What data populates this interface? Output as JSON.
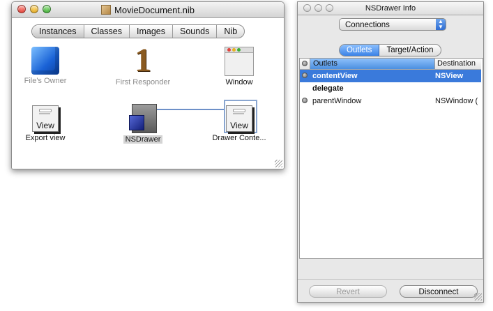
{
  "doc_window": {
    "title": "MovieDocument.nib",
    "tabs": [
      "Instances",
      "Classes",
      "Images",
      "Sounds",
      "Nib"
    ],
    "selected_tab": "Instances",
    "objects": [
      {
        "label": "File's Owner",
        "icon": "cube-icon",
        "dim": true
      },
      {
        "label": "First Responder",
        "icon": "first-responder-icon",
        "dim": true
      },
      {
        "label": "Window",
        "icon": "window-icon"
      },
      {
        "label": "Export view",
        "icon": "view-icon",
        "view_text": "View"
      },
      {
        "label": "NSDrawer",
        "icon": "drawer-icon",
        "selected": true
      },
      {
        "label": "Drawer Conte...",
        "icon": "view-icon",
        "view_text": "View"
      }
    ]
  },
  "info_window": {
    "title": "NSDrawer Info",
    "popup_value": "Connections",
    "tabs": [
      "Outlets",
      "Target/Action"
    ],
    "selected_tab": "Outlets",
    "columns": [
      "Outlets",
      "Destination"
    ],
    "rows": [
      {
        "name": "contentView",
        "destination": "NSView",
        "bold": true,
        "selected": true,
        "dot": true
      },
      {
        "name": "delegate",
        "destination": "",
        "bold": true,
        "selected": false,
        "dot": false
      },
      {
        "name": "parentWindow",
        "destination": "NSWindow (",
        "bold": false,
        "selected": false,
        "dot": true
      }
    ],
    "buttons": {
      "revert": "Revert",
      "disconnect": "Disconnect"
    }
  },
  "colors": {
    "selection": "#3a7adb",
    "connector": "#6d90c8",
    "close": "#e0443e",
    "minimize": "#e8b324",
    "zoom": "#3fae36"
  }
}
